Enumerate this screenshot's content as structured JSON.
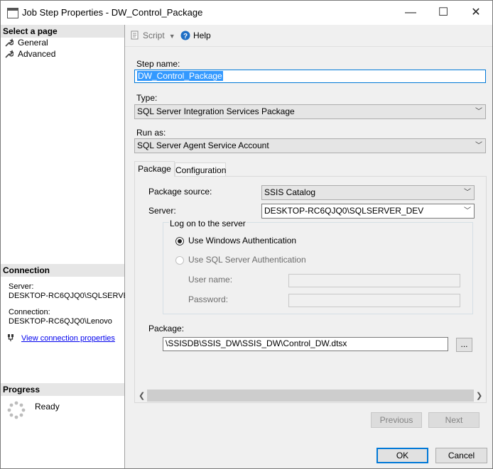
{
  "window": {
    "title": "Job Step Properties - DW_Control_Package"
  },
  "titlebar": {
    "minimize": "—",
    "maximize": "☐",
    "close": "✕"
  },
  "left": {
    "select_page_header": "Select a page",
    "pages": [
      {
        "label": "General",
        "icon": "wrench-icon"
      },
      {
        "label": "Advanced",
        "icon": "wrench-icon"
      }
    ],
    "connection_header": "Connection",
    "server_label": "Server:",
    "server_value": "DESKTOP-RC6QJQ0\\SQLSERVE",
    "connection_label": "Connection:",
    "connection_value": "DESKTOP-RC6QJQ0\\Lenovo",
    "view_link": "View connection properties",
    "progress_header": "Progress",
    "progress_status": "Ready"
  },
  "toolbar": {
    "script_label": "Script",
    "help_label": "Help"
  },
  "form": {
    "step_name_label": "Step name:",
    "step_name_value": "DW_Control_Package",
    "type_label": "Type:",
    "type_value": "SQL Server Integration Services Package",
    "run_as_label": "Run as:",
    "run_as_value": "SQL Server Agent Service Account"
  },
  "tabs": [
    {
      "label": "Package",
      "active": true
    },
    {
      "label": "Configuration",
      "active": false
    }
  ],
  "package_tab": {
    "source_label": "Package source:",
    "source_value": "SSIS Catalog",
    "server_label": "Server:",
    "server_value": "DESKTOP-RC6QJQ0\\SQLSERVER_DEV",
    "logon_group": "Log on to the server",
    "win_auth": "Use Windows Authentication",
    "sql_auth": "Use SQL Server Authentication",
    "username_label": "User name:",
    "password_label": "Password:",
    "package_label": "Package:",
    "package_value": "\\SSISDB\\SSIS_DW\\SSIS_DW\\Control_DW.dtsx",
    "browse_label": "..."
  },
  "buttons": {
    "previous": "Previous",
    "next": "Next",
    "ok": "OK",
    "cancel": "Cancel"
  },
  "colors": {
    "accent": "#0078d7",
    "selection": "#3399ff",
    "link": "#0000ee"
  }
}
